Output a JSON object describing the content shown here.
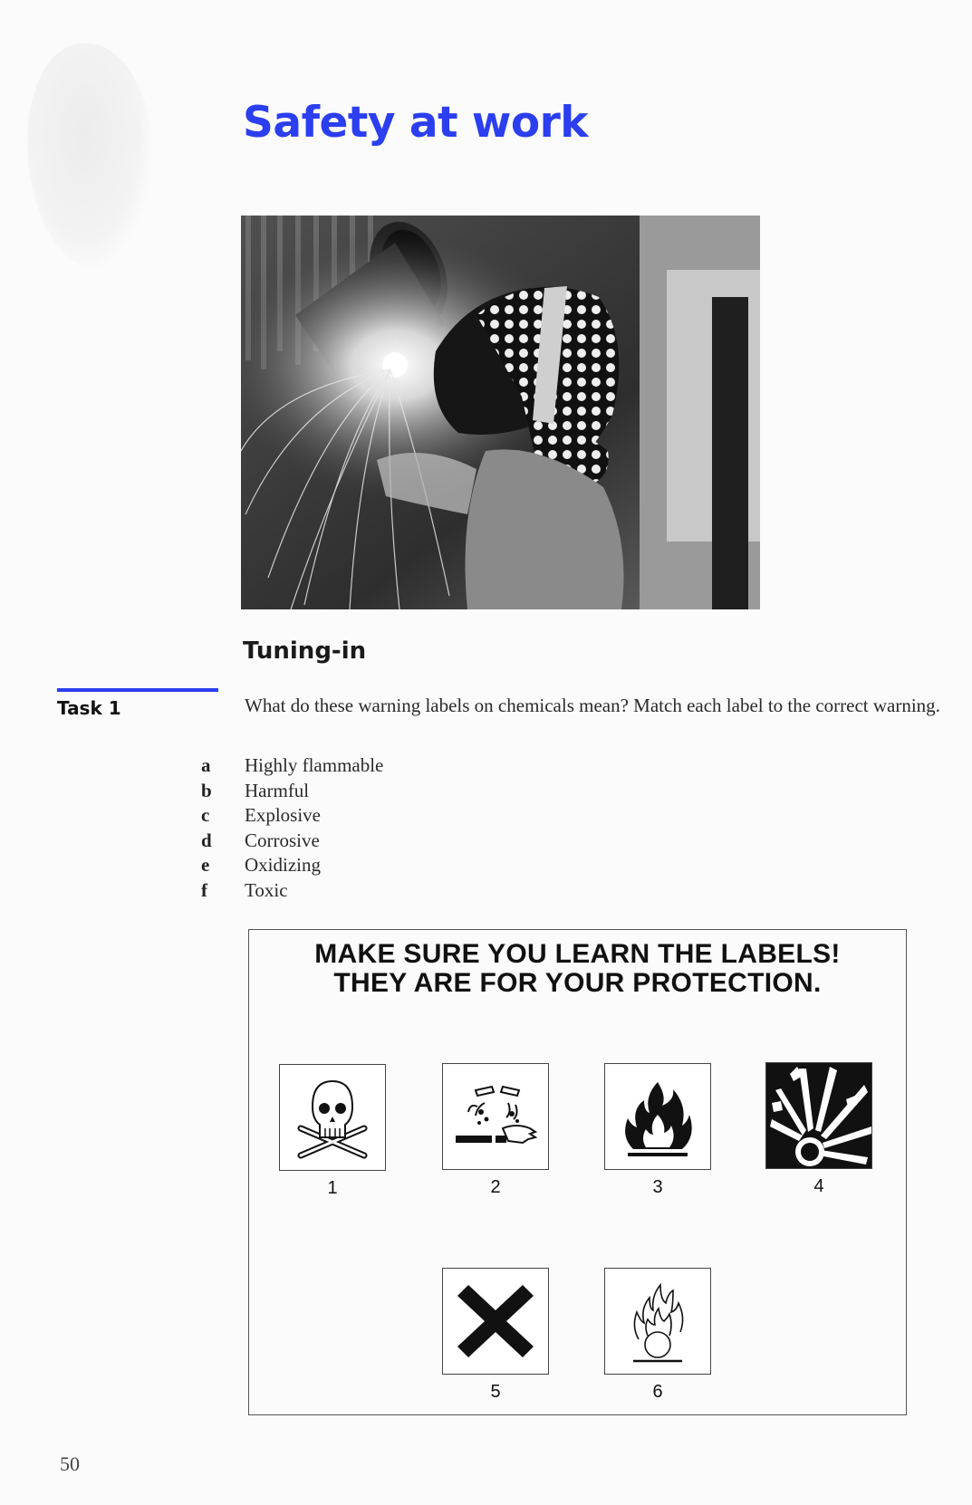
{
  "page": {
    "title": "Safety at work",
    "page_number": "50"
  },
  "section": {
    "heading": "Tuning-in",
    "task_label": "Task 1",
    "instructions": "What do these warning labels on chemicals mean? Match each label to the correct warning."
  },
  "options": [
    {
      "letter": "a",
      "text": "Highly flammable"
    },
    {
      "letter": "b",
      "text": "Harmful"
    },
    {
      "letter": "c",
      "text": "Explosive"
    },
    {
      "letter": "d",
      "text": "Corrosive"
    },
    {
      "letter": "e",
      "text": "Oxidizing"
    },
    {
      "letter": "f",
      "text": "Toxic"
    }
  ],
  "label_box": {
    "line1": "MAKE SURE YOU LEARN THE LABELS!",
    "line2": "THEY ARE FOR YOUR PROTECTION.",
    "labels": [
      {
        "number": "1",
        "icon": "skull-crossbones-icon"
      },
      {
        "number": "2",
        "icon": "corrosive-icon"
      },
      {
        "number": "3",
        "icon": "flame-icon"
      },
      {
        "number": "4",
        "icon": "explosion-icon"
      },
      {
        "number": "5",
        "icon": "cross-x-icon"
      },
      {
        "number": "6",
        "icon": "flame-over-circle-icon"
      }
    ]
  },
  "colors": {
    "title_blue": "#2b3ef0",
    "text": "#222222",
    "background": "#fbfbfb"
  }
}
